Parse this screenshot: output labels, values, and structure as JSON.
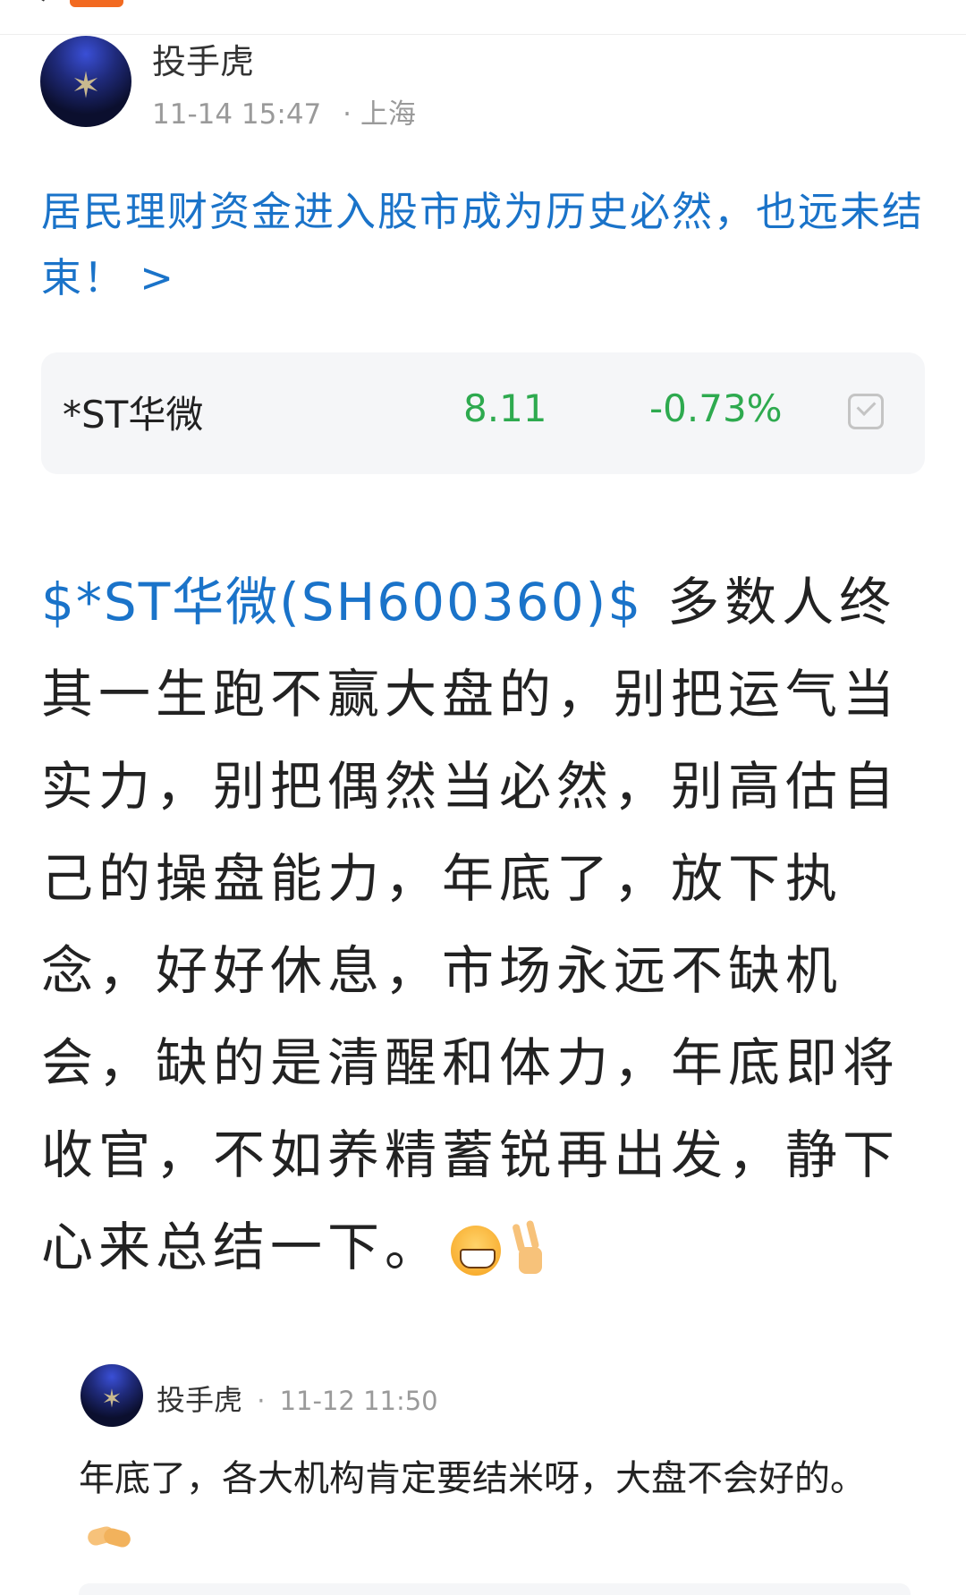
{
  "post": {
    "author": "投手虎",
    "time": "11-14 15:47",
    "location_sep": "·",
    "location": "上海",
    "title": "居民理财资金进入股市成为历史必然，也远未结束！ >",
    "stock_card": {
      "name": "*ST华微",
      "price": "8.11",
      "change": "-0.73%",
      "price_color": "#2eaa4f"
    },
    "body_stock_link": "$*ST华微(SH600360)$",
    "body_text": "多数人终其一生跑不赢大盘的，别把运气当实力，别把偶然当必然，别高估自己的操盘能力，年底了，放下执念，好好休息，市场永远不缺机会，缺的是清醒和体力，年底即将收官，不如养精蓄锐再出发，静下心来总结一下。",
    "body_emojis": [
      "grinning-face-emoji",
      "victory-hand-emoji"
    ]
  },
  "reply": {
    "author": "投手虎",
    "time_prefix": "·",
    "time": "11-12 11:50",
    "text": "年底了，各大机构肯定要结米呀，大盘不会好的。",
    "emoji": "handshake-emoji"
  },
  "colors": {
    "link_blue": "#1a73c9",
    "down_green": "#2eaa4f",
    "meta_gray": "#9a9a9a"
  }
}
